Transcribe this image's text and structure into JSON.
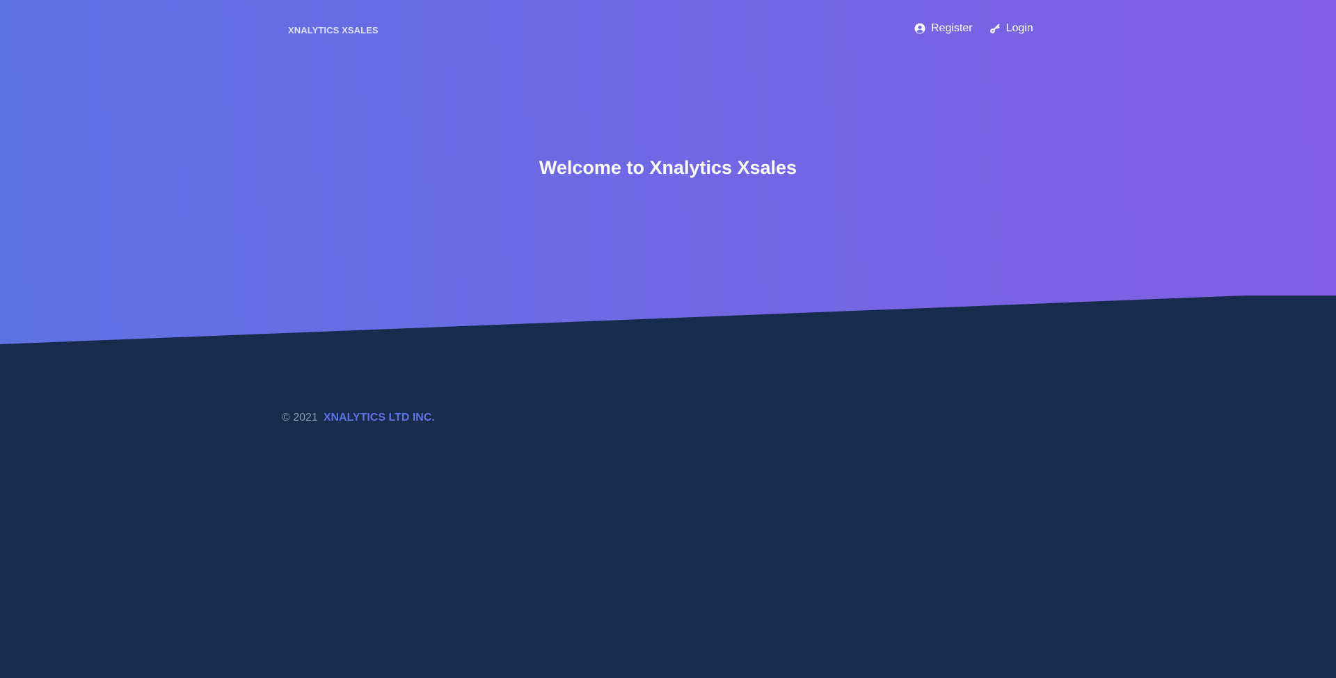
{
  "navbar": {
    "brand": "XNALYTICS XSALES",
    "links": [
      {
        "label": "Register",
        "icon": "circle-user-icon"
      },
      {
        "label": "Login",
        "icon": "key-icon"
      }
    ]
  },
  "hero": {
    "title": "Welcome to Xnalytics Xsales"
  },
  "footer": {
    "copyright": "© 2021",
    "company": "XNALYTICS LTD INC."
  },
  "colors": {
    "gradient_start": "#5e72e4",
    "gradient_end": "#825ee4",
    "footer_bg": "#172b4d",
    "accent": "#5e72e4",
    "muted_text": "#8898aa"
  }
}
